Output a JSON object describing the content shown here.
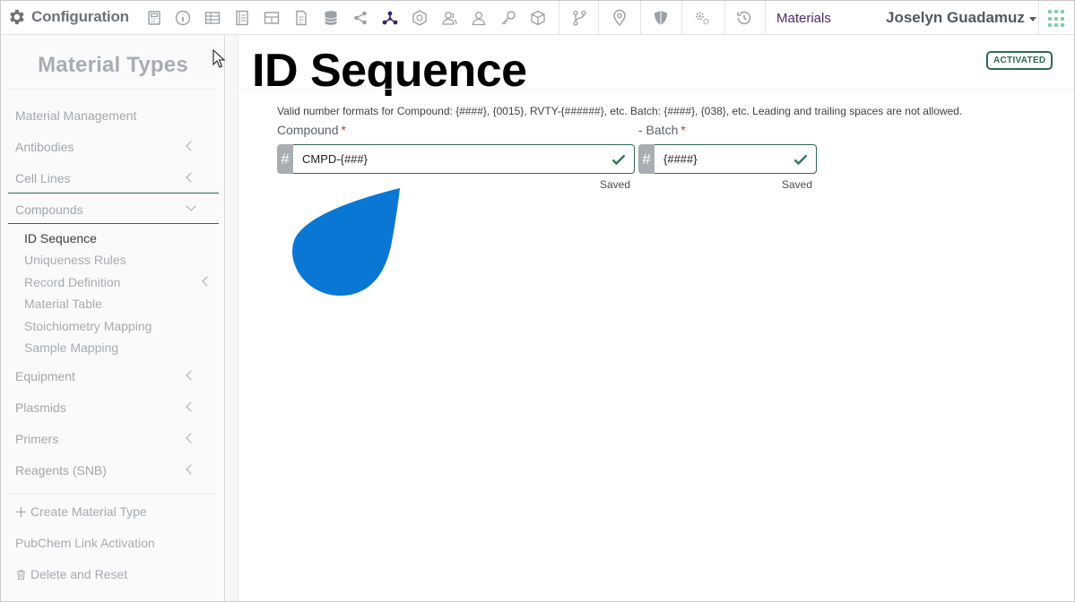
{
  "app": {
    "title": "Configuration"
  },
  "toolbar": {
    "icons": [
      "calculator-icon",
      "info-icon",
      "table-icon",
      "notebook-icon",
      "grid-table-icon",
      "document-icon",
      "database-icon",
      "share-icon",
      "molecule-icon",
      "hexagon-badge-icon",
      "users-icon",
      "user-icon",
      "key-icon",
      "cube-icon",
      "branch-icon",
      "location-pin-icon",
      "shield-icon",
      "gears-icon",
      "history-icon"
    ],
    "materials_label": "Materials",
    "user_name": "Joselyn Guadamuz"
  },
  "sidebar": {
    "title": "Material Types",
    "items": [
      {
        "label": "Material Management"
      },
      {
        "label": "Antibodies"
      },
      {
        "label": "Cell Lines"
      },
      {
        "label": "Compounds"
      },
      {
        "label": "Equipment"
      },
      {
        "label": "Plasmids"
      },
      {
        "label": "Primers"
      },
      {
        "label": "Reagents (SNB)"
      }
    ],
    "compounds_sub": [
      {
        "label": "ID Sequence"
      },
      {
        "label": "Uniqueness Rules"
      },
      {
        "label": "Record Definition"
      },
      {
        "label": "Material Table"
      },
      {
        "label": "Stoichiometry Mapping"
      },
      {
        "label": "Sample Mapping"
      }
    ],
    "actions": [
      {
        "label": "Create Material Type"
      },
      {
        "label": "PubChem Link Activation"
      },
      {
        "label": "Delete and Reset"
      }
    ]
  },
  "main": {
    "title": "ID Sequence",
    "status": "ACTIVATED",
    "help_text": "Valid number formats for Compound: {####}, {0015}, RVTY-{######}, etc. Batch: {####}, {038}, etc. Leading and trailing spaces are not allowed.",
    "compound": {
      "label": "Compound",
      "required_mark": "*",
      "addon": "#",
      "value": "CMPD-{###}",
      "status": "Saved"
    },
    "batch": {
      "label": "- Batch",
      "required_mark": "*",
      "addon": "#",
      "value": "{####}",
      "status": "Saved"
    }
  },
  "colors": {
    "accent_green": "#2f6b4f",
    "purple": "#4a2d73",
    "drop_blue": "#0a77d4",
    "required_red": "#c0392b"
  }
}
